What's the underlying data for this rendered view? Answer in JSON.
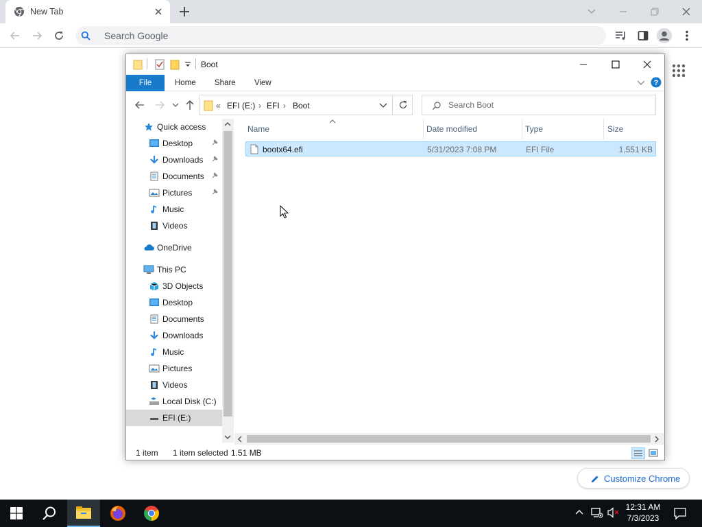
{
  "chrome": {
    "tab_title": "New Tab",
    "omnibox_placeholder": "Search Google",
    "customize_label": "Customize Chrome"
  },
  "explorer": {
    "title": "Boot",
    "ribbon": {
      "file": "File",
      "home": "Home",
      "share": "Share",
      "view": "View"
    },
    "address": {
      "overflow": "«",
      "crumbs": [
        "EFI (E:)",
        "EFI",
        "Boot"
      ]
    },
    "search_placeholder": "Search Boot",
    "nav": {
      "quick_access": "Quick access",
      "qa_items": [
        "Desktop",
        "Downloads",
        "Documents",
        "Pictures",
        "Music",
        "Videos"
      ],
      "onedrive": "OneDrive",
      "this_pc": "This PC",
      "pc_items": [
        "3D Objects",
        "Desktop",
        "Documents",
        "Downloads",
        "Music",
        "Pictures",
        "Videos",
        "Local Disk (C:)",
        "EFI (E:)"
      ]
    },
    "columns": {
      "name": "Name",
      "date": "Date modified",
      "type": "Type",
      "size": "Size"
    },
    "files": [
      {
        "name": "bootx64.efi",
        "date": "5/31/2023 7:08 PM",
        "type": "EFI File",
        "size": "1,551 KB",
        "selected": true
      }
    ],
    "status": {
      "count": "1 item",
      "selected": "1 item selected",
      "size": "1.51 MB"
    }
  },
  "taskbar": {
    "time": "12:31 AM",
    "date": "7/3/2023"
  },
  "colors": {
    "accent": "#1979ca",
    "selection": "#cce8ff",
    "taskbar": "#0c1014",
    "chrome_frame": "#dee1e6"
  }
}
